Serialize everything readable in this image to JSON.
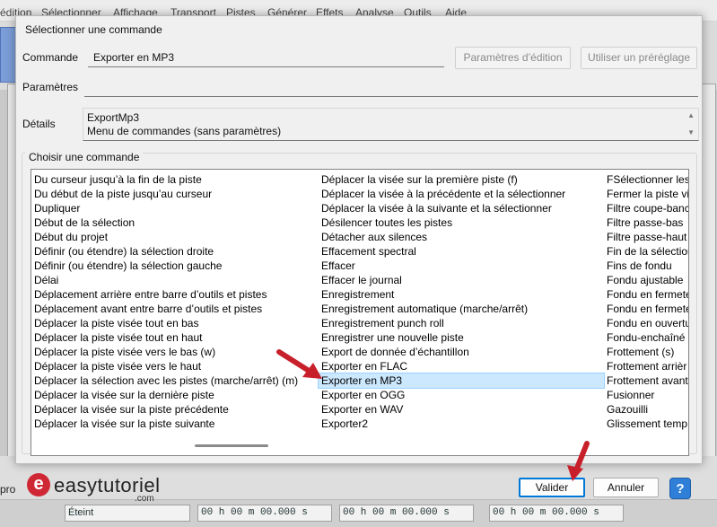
{
  "background_menu": [
    "édition",
    "Sélectionner",
    "Affichage",
    "Transport",
    "Pistes",
    "Générer",
    "Effets",
    "Analyse",
    "Outils",
    "Aide"
  ],
  "background_bottom": {
    "label": "pro",
    "dropdown": "Éteint",
    "time1": "00 h 00 m 00.000 s",
    "time2": "00 h 00 m 00.000 s",
    "time3": "00 h 00 m 00.000 s"
  },
  "dialog": {
    "title": "Sélectionner une commande",
    "command_label": "Commande",
    "command_value": "Exporter en MP3",
    "edit_params_button": "Paramètres d’édition",
    "use_preset_button": "Utiliser un préréglage",
    "params_label": "Paramètres",
    "details_label": "Détails",
    "details_line1": "ExportMp3",
    "details_line2": "Menu de commandes (sans paramètres)",
    "group_title": "Choisir une commande",
    "ok_button": "Valider",
    "cancel_button": "Annuler",
    "help_button": "?"
  },
  "commands": {
    "col1": [
      "Du curseur jusqu’à la fin de la piste",
      "Du début de la piste jusqu’au curseur",
      "Dupliquer",
      "Début de la sélection",
      "Début du projet",
      "Définir (ou étendre) la sélection droite",
      "Définir (ou étendre) la sélection gauche",
      "Délai",
      "Déplacement arrière entre barre d’outils et pistes",
      "Déplacement avant entre barre d’outils et pistes",
      "Déplacer la piste visée tout en bas",
      "Déplacer la piste visée tout en haut",
      "Déplacer la piste visée vers le bas (w)",
      "Déplacer la piste visée vers le haut",
      "Déplacer la sélection avec les pistes (marche/arrêt) (m)",
      "Déplacer la visée sur la dernière piste",
      "Déplacer la visée sur la piste précédente",
      "Déplacer la visée sur la piste suivante"
    ],
    "col2": [
      "Déplacer la visée sur la première piste (f)",
      "Déplacer la visée à la précédente et la sélectionner",
      "Déplacer la visée à la suivante et la sélectionner",
      "Désilencer toutes les pistes",
      "Détacher aux silences",
      "Effacement spectral",
      "Effacer",
      "Effacer le journal",
      "Enregistrement",
      "Enregistrement automatique (marche/arrêt)",
      "Enregistrement punch  roll",
      "Enregistrer une nouvelle piste",
      "Export de donnée d’échantillon",
      "Exporter en FLAC",
      "Exporter en MP3",
      "Exporter en OGG",
      "Exporter en WAV",
      "Exporter2"
    ],
    "col3": [
      "FSélectionner les",
      "Fermer la piste vi",
      "Filtre coupe-banc",
      "Filtre passe-bas",
      "Filtre passe-haut",
      "Fin de la sélection",
      "Fins de fondu",
      "Fondu ajustable",
      "Fondu en fermete",
      "Fondu en fermete",
      "Fondu en ouvertu",
      "Fondu-enchaîné",
      "Frottement (s)",
      "Frottement arrièr",
      "Frottement avant",
      "Fusionner",
      "Gazouilli",
      "Glissement temp"
    ],
    "selected": "Exporter en MP3"
  },
  "watermark": {
    "logo_letter": "e",
    "name": "easytutoriel",
    "domain": ".com"
  },
  "colors": {
    "arrow": "#c8202a",
    "accent": "#0078d7",
    "selection": "#cce8ff"
  }
}
